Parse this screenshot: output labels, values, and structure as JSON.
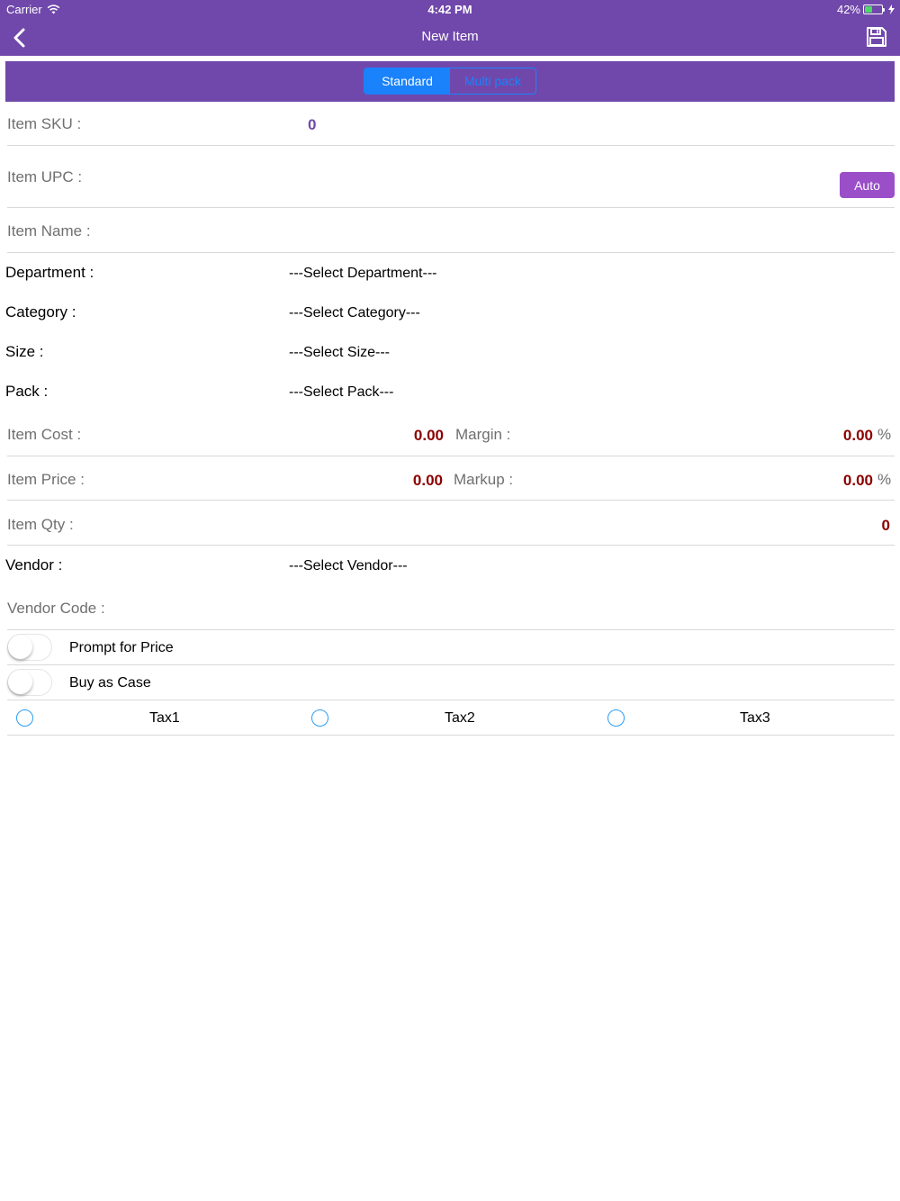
{
  "status_bar": {
    "carrier": "Carrier",
    "time": "4:42 PM",
    "battery": "42%",
    "battery_level": 0.42
  },
  "nav": {
    "title": "New Item",
    "back_icon": "chevron-left-icon",
    "save_icon": "save-icon"
  },
  "segments": {
    "standard": "Standard",
    "multipack": "Multi pack"
  },
  "fields": {
    "sku_label": "Item SKU :",
    "sku_value": "0",
    "upc_label": "Item UPC :",
    "auto_button": "Auto",
    "name_label": "Item Name :",
    "department_label": "Department :",
    "department_value": "---Select Department---",
    "category_label": "Category :",
    "category_value": "---Select Category---",
    "size_label": "Size :",
    "size_value": "---Select Size---",
    "pack_label": "Pack :",
    "pack_value": "---Select Pack---",
    "cost_label": "Item Cost :",
    "cost_value": "0.00",
    "margin_label": "Margin :",
    "margin_value": "0.00",
    "price_label": "Item Price :",
    "price_value": "0.00",
    "markup_label": "Markup :",
    "markup_value": "0.00",
    "percent": "%",
    "qty_label": "Item Qty :",
    "qty_value": "0",
    "vendor_label": "Vendor :",
    "vendor_value": "---Select Vendor---",
    "vendor_code_label": "Vendor Code :"
  },
  "toggles": {
    "prompt_price": "Prompt for Price",
    "buy_case": "Buy as Case"
  },
  "taxes": [
    "Tax1",
    "Tax2",
    "Tax3"
  ],
  "colors": {
    "brand": "#7048ab",
    "segment_blue": "#1a82fb",
    "auto_button": "#9a4fc9",
    "value_red": "#8b0000"
  }
}
